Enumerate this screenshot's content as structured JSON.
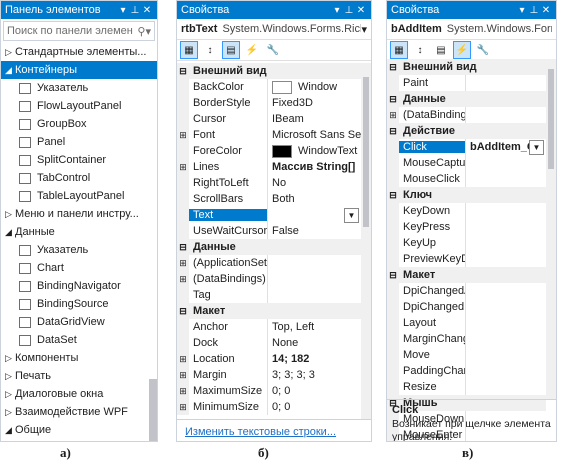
{
  "panel_a": {
    "title": "Панель элементов",
    "search_placeholder": "Поиск по панели элемен",
    "items": [
      {
        "label": "Стандартные элементы...",
        "type": "group",
        "expanded": false
      },
      {
        "label": "Контейнеры",
        "type": "group",
        "expanded": true,
        "selected": true
      },
      {
        "label": "Указатель",
        "type": "item"
      },
      {
        "label": "FlowLayoutPanel",
        "type": "item"
      },
      {
        "label": "GroupBox",
        "type": "item"
      },
      {
        "label": "Panel",
        "type": "item"
      },
      {
        "label": "SplitContainer",
        "type": "item"
      },
      {
        "label": "TabControl",
        "type": "item"
      },
      {
        "label": "TableLayoutPanel",
        "type": "item"
      },
      {
        "label": "Меню и панели инстру...",
        "type": "group",
        "expanded": false
      },
      {
        "label": "Данные",
        "type": "group",
        "expanded": true
      },
      {
        "label": "Указатель",
        "type": "item"
      },
      {
        "label": "Chart",
        "type": "item"
      },
      {
        "label": "BindingNavigator",
        "type": "item"
      },
      {
        "label": "BindingSource",
        "type": "item"
      },
      {
        "label": "DataGridView",
        "type": "item"
      },
      {
        "label": "DataSet",
        "type": "item"
      },
      {
        "label": "Компоненты",
        "type": "group",
        "expanded": false
      },
      {
        "label": "Печать",
        "type": "group",
        "expanded": false
      },
      {
        "label": "Диалоговые окна",
        "type": "group",
        "expanded": false
      },
      {
        "label": "Взаимодействие WPF",
        "type": "group",
        "expanded": false
      },
      {
        "label": "Общие",
        "type": "group",
        "expanded": true
      }
    ],
    "caption": "а)"
  },
  "panel_b": {
    "title": "Свойства",
    "object_name": "rtbText",
    "object_type": "System.Windows.Forms.Rich",
    "rows": [
      {
        "kind": "cat",
        "name": "Внешний вид"
      },
      {
        "name": "BackColor",
        "value": "Window",
        "swatch": "#ffffff"
      },
      {
        "name": "BorderStyle",
        "value": "Fixed3D"
      },
      {
        "name": "Cursor",
        "value": "IBeam"
      },
      {
        "name": "Font",
        "value": "Microsoft Sans Seri",
        "expand": true
      },
      {
        "name": "ForeColor",
        "value": "WindowText",
        "swatch": "#000000"
      },
      {
        "name": "Lines",
        "value": "Массив String[]",
        "expand": true,
        "bold": true
      },
      {
        "name": "RightToLeft",
        "value": "No"
      },
      {
        "name": "ScrollBars",
        "value": "Both"
      },
      {
        "name": "Text",
        "value": "",
        "selected": true,
        "dropdown": true
      },
      {
        "name": "UseWaitCursor",
        "value": "False"
      },
      {
        "kind": "cat",
        "name": "Данные"
      },
      {
        "name": "(ApplicationSet",
        "value": "",
        "expand": true
      },
      {
        "name": "(DataBindings)",
        "value": "",
        "expand": true
      },
      {
        "name": "Tag",
        "value": ""
      },
      {
        "kind": "cat",
        "name": "Макет"
      },
      {
        "name": "Anchor",
        "value": "Top, Left"
      },
      {
        "name": "Dock",
        "value": "None"
      },
      {
        "name": "Location",
        "value": "14; 182",
        "expand": true,
        "bold": true
      },
      {
        "name": "Margin",
        "value": "3; 3; 3; 3",
        "expand": true
      },
      {
        "name": "MaximumSize",
        "value": "0; 0",
        "expand": true
      },
      {
        "name": "MinimumSize",
        "value": "0; 0",
        "expand": true
      }
    ],
    "link": "Изменить текстовые строки...",
    "caption": "б)"
  },
  "panel_c": {
    "title": "Свойства",
    "object_name": "bAddItem",
    "object_type": "System.Windows.Forms.Bu",
    "rows": [
      {
        "kind": "cat",
        "name": "Внешний вид"
      },
      {
        "name": "Paint",
        "value": ""
      },
      {
        "kind": "cat",
        "name": "Данные"
      },
      {
        "name": "(DataBindings)",
        "value": "",
        "expand": true
      },
      {
        "kind": "cat",
        "name": "Действие"
      },
      {
        "name": "Click",
        "value": "bAddItem_Click",
        "selected": true,
        "dropdown": true,
        "bold": true
      },
      {
        "name": "MouseCapture",
        "value": ""
      },
      {
        "name": "MouseClick",
        "value": ""
      },
      {
        "kind": "cat",
        "name": "Ключ"
      },
      {
        "name": "KeyDown",
        "value": ""
      },
      {
        "name": "KeyPress",
        "value": ""
      },
      {
        "name": "KeyUp",
        "value": ""
      },
      {
        "name": "PreviewKeyDov",
        "value": ""
      },
      {
        "kind": "cat",
        "name": "Макет"
      },
      {
        "name": "DpiChangedAft",
        "value": ""
      },
      {
        "name": "DpiChangedBe",
        "value": ""
      },
      {
        "name": "Layout",
        "value": ""
      },
      {
        "name": "MarginChange",
        "value": ""
      },
      {
        "name": "Move",
        "value": ""
      },
      {
        "name": "PaddingChang",
        "value": ""
      },
      {
        "name": "Resize",
        "value": ""
      },
      {
        "kind": "cat",
        "name": "Мышь"
      },
      {
        "name": "MouseDown",
        "value": ""
      },
      {
        "name": "MouseEnter",
        "value": ""
      }
    ],
    "desc_title": "Click",
    "desc_text": "Возникает при щелчке элемента управления.",
    "caption": "в)"
  },
  "colors": {
    "accent": "#007acc",
    "border": "#ccd3dd",
    "category_bg": "#f0f0f0"
  }
}
